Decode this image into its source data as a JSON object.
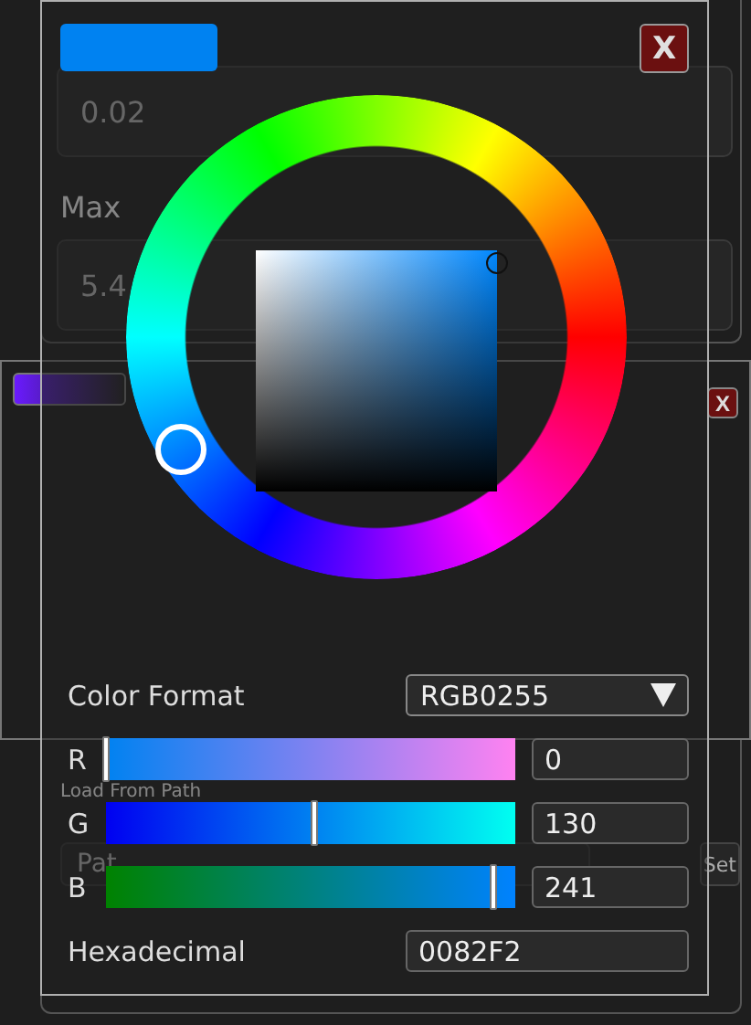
{
  "background": {
    "range_panel": {
      "min_field": "0.02",
      "max_label": "Max",
      "max_field": "5.4"
    },
    "gradient_panel": {
      "close": "X"
    },
    "path_panel": {
      "label": "Load From Path",
      "path_placeholder": "Pat",
      "set_button": "Set"
    }
  },
  "color_picker": {
    "close": "X",
    "hue_wheel": {
      "level": 0.578
    },
    "saturation": {
      "level": 1
    },
    "brightness": {
      "level": 0.95
    },
    "format_label": "Color Format",
    "format": "RGB0255",
    "channels": [
      {
        "label": "R",
        "value": "0",
        "level": 0
      },
      {
        "label": "G",
        "value": "130",
        "level": 0.51
      },
      {
        "label": "B",
        "value": "241",
        "level": 0.945
      }
    ],
    "hex_label": "Hexadecimal",
    "hex": "0082F2"
  }
}
